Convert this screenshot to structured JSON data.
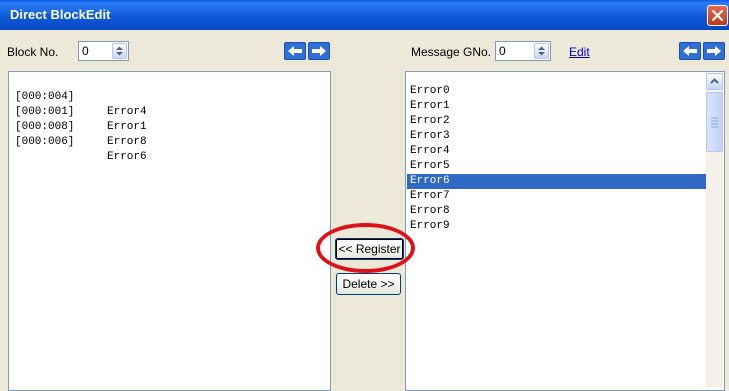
{
  "window": {
    "title": "Direct BlockEdit"
  },
  "left_panel": {
    "block_no_label": "Block No.",
    "block_no_value": "0",
    "items": [
      {
        "code": "[000:004]",
        "name": "Error4"
      },
      {
        "code": "[000:001]",
        "name": "Error1"
      },
      {
        "code": "[000:008]",
        "name": "Error8"
      },
      {
        "code": "[000:006]",
        "name": "Error6"
      }
    ]
  },
  "right_panel": {
    "message_label": "Message",
    "gno_label": "GNo.",
    "gno_value": "0",
    "edit_link": "Edit",
    "items": [
      "Error0",
      "Error1",
      "Error2",
      "Error3",
      "Error4",
      "Error5",
      "Error6",
      "Error7",
      "Error8",
      "Error9"
    ],
    "selected_index": 6
  },
  "buttons": {
    "register": "<< Register",
    "delete": "Delete >>"
  },
  "colors": {
    "title_bar": "#0a5ee8",
    "selection": "#316ac5",
    "annotation": "#e0101a"
  }
}
